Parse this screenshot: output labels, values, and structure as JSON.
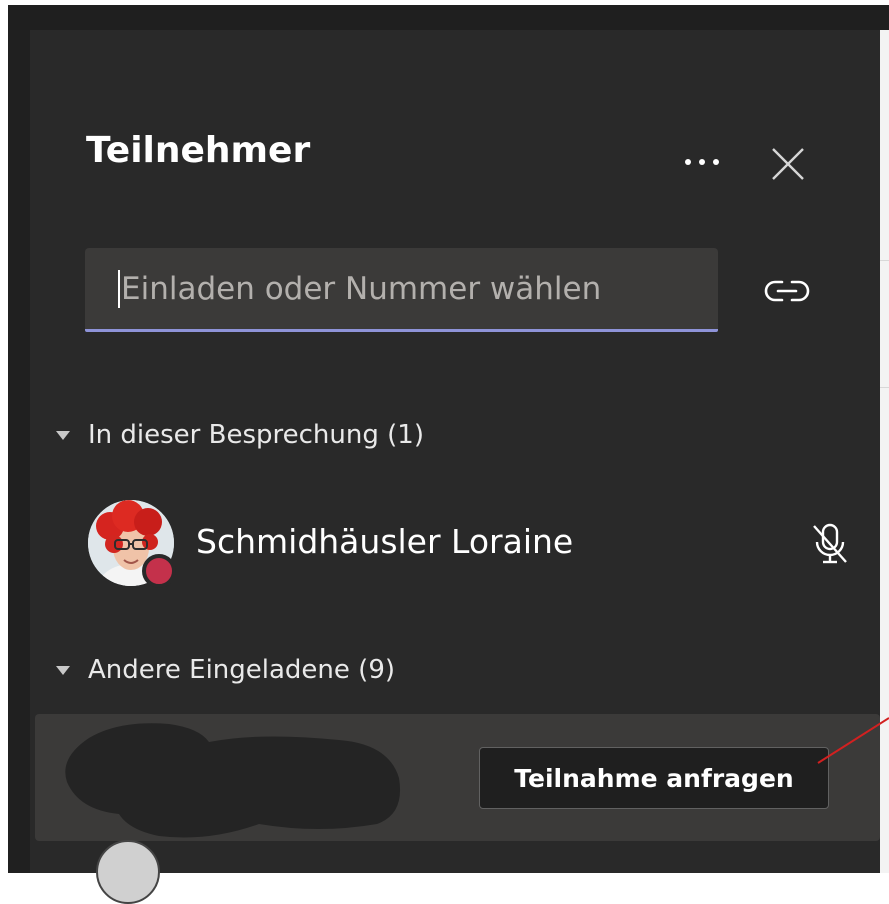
{
  "panel": {
    "title": "Teilnehmer",
    "more_icon": "more-horizontal-icon",
    "close_icon": "close-icon"
  },
  "search": {
    "placeholder": "Einladen oder Nummer wählen",
    "value": "",
    "link_icon": "link-icon"
  },
  "sections": {
    "in_meeting": {
      "label": "In dieser Besprechung (1)",
      "participants": [
        {
          "name": "Schmidhäusler Loraine",
          "status": "busy",
          "status_color": "#c4314b",
          "mic_icon": "mic-off-icon"
        }
      ]
    },
    "others": {
      "label": "Andere Eingeladene (9)",
      "rows": [
        {
          "name_redacted": true,
          "action_label": "Teilnahme anfragen"
        }
      ]
    }
  },
  "colors": {
    "panel_bg": "#292929",
    "input_bg": "#3b3a39",
    "input_underline": "#8e93d8",
    "annotation": "#d22020"
  }
}
